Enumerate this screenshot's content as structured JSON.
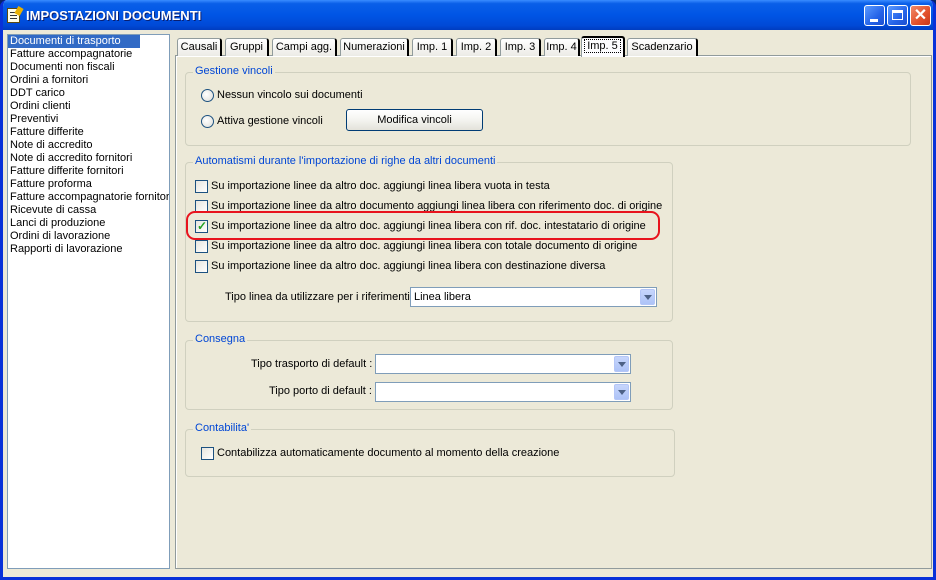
{
  "window": {
    "title": "IMPOSTAZIONI DOCUMENTI",
    "buttons": {
      "minimize": "_",
      "maximize": "□",
      "close": "✕"
    }
  },
  "document_types": [
    "Documenti di trasporto",
    "Fatture accompagnatorie",
    "Documenti non fiscali",
    "Ordini a fornitori",
    "DDT carico",
    "Ordini clienti",
    "Preventivi",
    "Fatture differite",
    "Note di accredito",
    "Note di accredito fornitori",
    "Fatture differite fornitori",
    "Fatture proforma",
    "Fatture accompagnatorie fornitori",
    "Ricevute di cassa",
    "Lanci di produzione",
    "Ordini di lavorazione",
    "Rapporti di lavorazione"
  ],
  "selected_document_type": "Documenti di trasporto",
  "tabs": [
    "Causali",
    "Gruppi",
    "Campi agg.",
    "Numerazioni",
    "Imp. 1",
    "Imp. 2",
    "Imp. 3",
    "Imp. 4",
    "Imp. 5",
    "Scadenzario"
  ],
  "active_tab": "Imp. 5",
  "gestione_vincoli": {
    "title": "Gestione vincoli",
    "option_none": "Nessun vincolo sui documenti",
    "option_active": "Attiva gestione vincoli",
    "modify_button": "Modifica vincoli"
  },
  "automatismi": {
    "title": "Automatismi durante l'importazione di righe da altri documenti",
    "options": [
      {
        "label": "Su importazione linee da altro doc. aggiungi linea libera vuota in testa",
        "checked": false
      },
      {
        "label": "Su importazione linee da altro documento aggiungi linea libera con riferimento doc. di origine",
        "checked": false
      },
      {
        "label": "Su importazione linee da altro doc. aggiungi linea libera con rif. doc. intestatario di origine",
        "checked": true
      },
      {
        "label": "Su importazione linee da altro doc. aggiungi linea libera con totale documento di origine",
        "checked": false
      },
      {
        "label": "Su importazione linee da altro doc. aggiungi linea libera con destinazione diversa",
        "checked": false
      }
    ],
    "tipo_linea_label": "Tipo linea da utilizzare per i riferimenti :",
    "tipo_linea_value": "Linea libera"
  },
  "consegna": {
    "title": "Consegna",
    "tipo_trasporto_label": "Tipo trasporto di default :",
    "tipo_trasporto_value": "",
    "tipo_porto_label": "Tipo porto di default :",
    "tipo_porto_value": ""
  },
  "contabilita": {
    "title": "Contabilita'",
    "option": "Contabilizza automaticamente documento al momento della creazione",
    "checked": false
  },
  "colors": {
    "title_bar": "#0055e5",
    "selection": "#316ac5",
    "group_title": "#0046d5",
    "highlight": "#e8141e"
  }
}
